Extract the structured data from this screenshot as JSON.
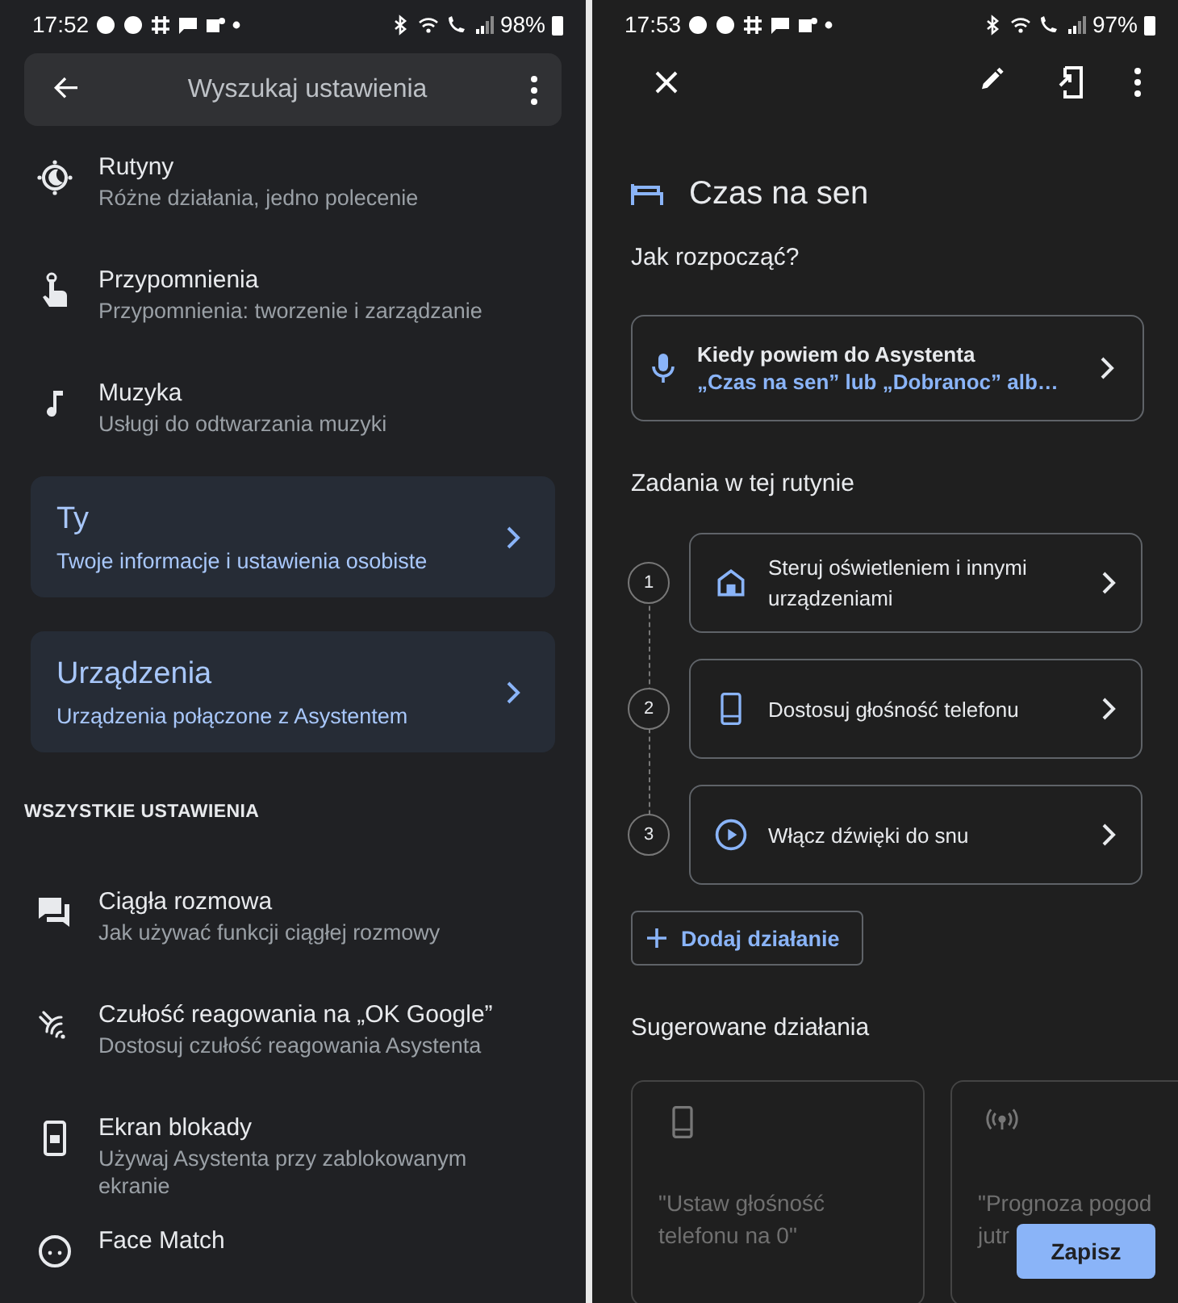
{
  "left": {
    "status_bar": {
      "time": "17:52",
      "battery": "98%"
    },
    "search": {
      "placeholder": "Wyszukaj ustawienia"
    },
    "top_items": [
      {
        "kind": "routine",
        "title": "Rutyny",
        "subtitle": "Różne działania, jedno polecenie"
      },
      {
        "kind": "reminder",
        "title": "Przypomnienia",
        "subtitle": "Przypomnienia: tworzenie i zarządzanie"
      },
      {
        "kind": "music",
        "title": "Muzyka",
        "subtitle": "Usługi do odtwarzania muzyki"
      }
    ],
    "cards": [
      {
        "title": "Ty",
        "subtitle": "Twoje informacje i ustawienia osobiste"
      },
      {
        "title": "Urządzenia",
        "subtitle": "Urządzenia połączone z Asystentem"
      }
    ],
    "section_header": "WSZYSTKIE USTAWIENIA",
    "settings": [
      {
        "kind": "chat",
        "title": "Ciągła rozmowa",
        "subtitle": "Jak używać funkcji ciągłej rozmowy"
      },
      {
        "kind": "sensitivity",
        "title": "Czułość reagowania na „OK Google”",
        "subtitle": "Dostosuj czułość reagowania Asystenta"
      },
      {
        "kind": "lock",
        "title": "Ekran blokady",
        "subtitle": "Używaj Asystenta przy zablokowanym ekranie"
      },
      {
        "kind": "face",
        "title": "Face Match"
      }
    ]
  },
  "right": {
    "status_bar": {
      "time": "17:53",
      "battery": "97%"
    },
    "title": "Czas na sen",
    "start_heading": "Jak rozpocząć?",
    "trigger": {
      "title": "Kiedy powiem do Asystenta",
      "phrase": "„Czas na sen” lub „Dobranoc” alb…"
    },
    "tasks_heading": "Zadania w tej rutynie",
    "tasks": [
      {
        "number": "1",
        "kind": "home",
        "label": "Steruj oświetleniem i innymi urządzeniami"
      },
      {
        "number": "2",
        "kind": "phone",
        "label": "Dostosuj głośność telefonu"
      },
      {
        "number": "3",
        "kind": "play",
        "label": "Włącz dźwięki do snu"
      }
    ],
    "add_button": "Dodaj działanie",
    "suggested_heading": "Sugerowane działania",
    "suggestions": [
      {
        "kind": "phone",
        "lines": [
          "\"Ustaw głośność",
          "telefonu na 0\""
        ]
      },
      {
        "kind": "broadcast",
        "lines": [
          "\"Prognoza pogod",
          "jutr"
        ]
      }
    ],
    "save_button": "Zapisz"
  }
}
